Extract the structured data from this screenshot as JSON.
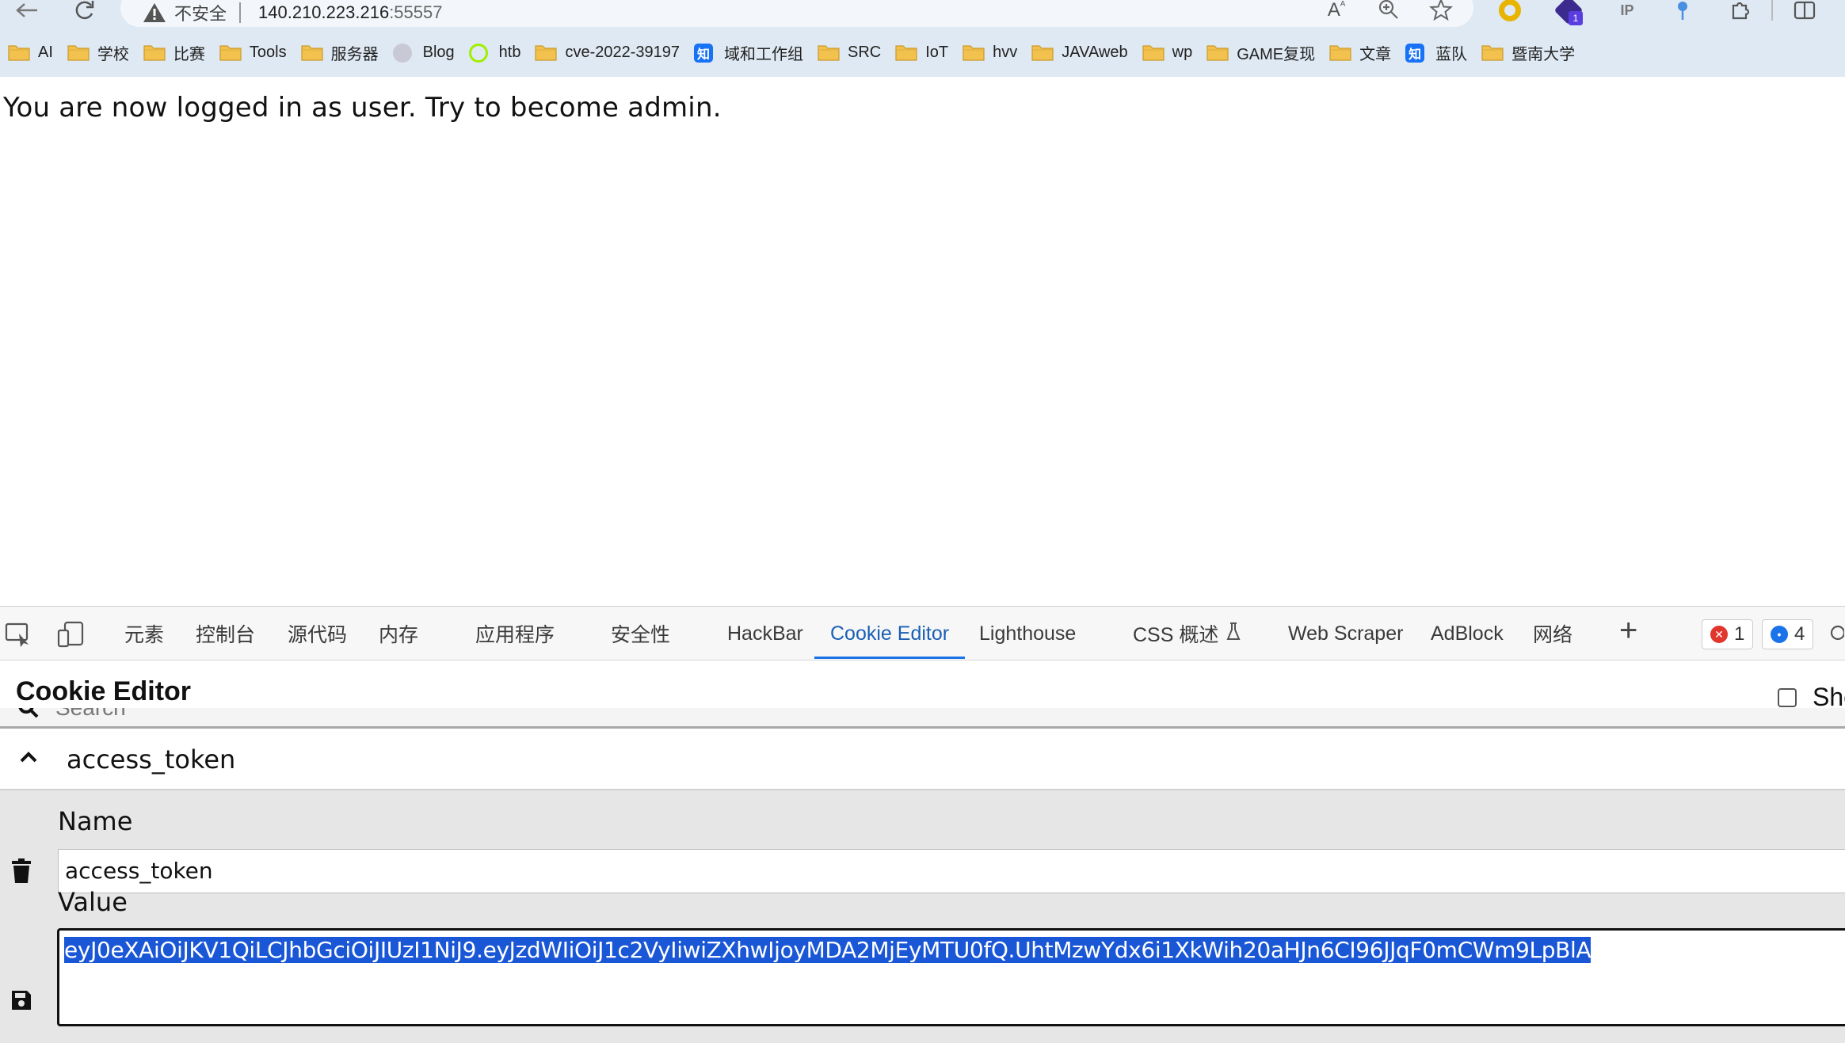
{
  "browser": {
    "address": {
      "insecure_label": "不安全",
      "host": "140.210.223.216",
      "port": ":55557"
    },
    "bookmarks": [
      {
        "label": "AI",
        "icon": "folder-icon"
      },
      {
        "label": "学校",
        "icon": "folder-icon"
      },
      {
        "label": "比赛",
        "icon": "folder-icon"
      },
      {
        "label": "Tools",
        "icon": "folder-icon"
      },
      {
        "label": "服务器",
        "icon": "folder-icon"
      },
      {
        "label": "Blog",
        "icon": "blog-avatar-icon"
      },
      {
        "label": "htb",
        "icon": "htb-icon"
      },
      {
        "label": "cve-2022-39197",
        "icon": "folder-icon"
      },
      {
        "label": "域和工作组",
        "icon": "zhihu-icon"
      },
      {
        "label": "SRC",
        "icon": "folder-icon"
      },
      {
        "label": "IoT",
        "icon": "folder-icon"
      },
      {
        "label": "hvv",
        "icon": "folder-icon"
      },
      {
        "label": "JAVAweb",
        "icon": "folder-icon"
      },
      {
        "label": "wp",
        "icon": "folder-icon"
      },
      {
        "label": "GAME复现",
        "icon": "folder-icon"
      },
      {
        "label": "文章",
        "icon": "folder-icon"
      },
      {
        "label": "蓝队",
        "icon": "zhihu-icon"
      },
      {
        "label": "暨南大学",
        "icon": "folder-icon"
      }
    ],
    "zhihu_glyph": "知"
  },
  "page": {
    "message": "You are now logged in as user. Try to become admin."
  },
  "devtools": {
    "tabs": {
      "elements": "元素",
      "console": "控制台",
      "sources": "源代码",
      "memory": "内存",
      "application": "应用程序",
      "security": "安全性",
      "hackbar": "HackBar",
      "cookie_editor": "Cookie Editor",
      "lighthouse": "Lighthouse",
      "css_overview": "CSS 概述",
      "web_scraper": "Web Scraper",
      "adblock": "AdBlock",
      "network": "网络"
    },
    "active_tab": "Cookie Editor",
    "errors_count": "1",
    "messages_count": "4",
    "colors": {
      "accent": "#1a73e8",
      "selection": "#1a57d6",
      "error": "#e0362c",
      "message": "#1a73e8"
    }
  },
  "cookie_editor": {
    "title": "Cookie Editor",
    "show_advanced_label": "Sho",
    "search_placeholder": "Search",
    "cookie_name": "access_token",
    "name_label": "Name",
    "name_value": "access_token",
    "value_label": "Value",
    "value": "eyJ0eXAiOiJKV1QiLCJhbGciOiJIUzI1NiJ9.eyJzdWIiOiJ1c2VyIiwiZXhwIjoyMDA2MjEyMTU0fQ.UhtMzwYdx6i1XkWih20aHJn6CI96JJqF0mCWm9LpBlA"
  }
}
